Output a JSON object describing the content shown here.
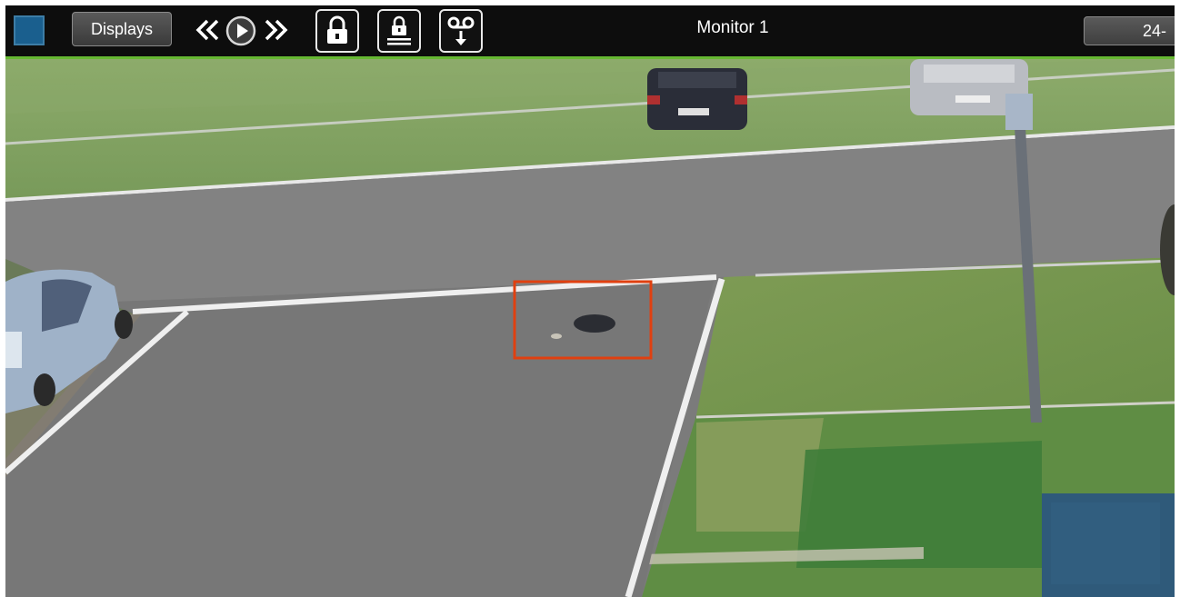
{
  "toolbar": {
    "displays_label": "Displays",
    "monitor_title": "Monitor 1",
    "timestamp": "24-"
  },
  "icons": {
    "rewind": "rewind-icon",
    "play": "play-icon",
    "fast_forward": "fast-forward-icon",
    "lock": "lock-icon",
    "lock_all": "lock-all-icon",
    "tape_export": "tape-export-icon"
  },
  "colors": {
    "accent_blue": "#1a5f8e",
    "status_green": "#66b832",
    "detection_box": "#e04010"
  }
}
